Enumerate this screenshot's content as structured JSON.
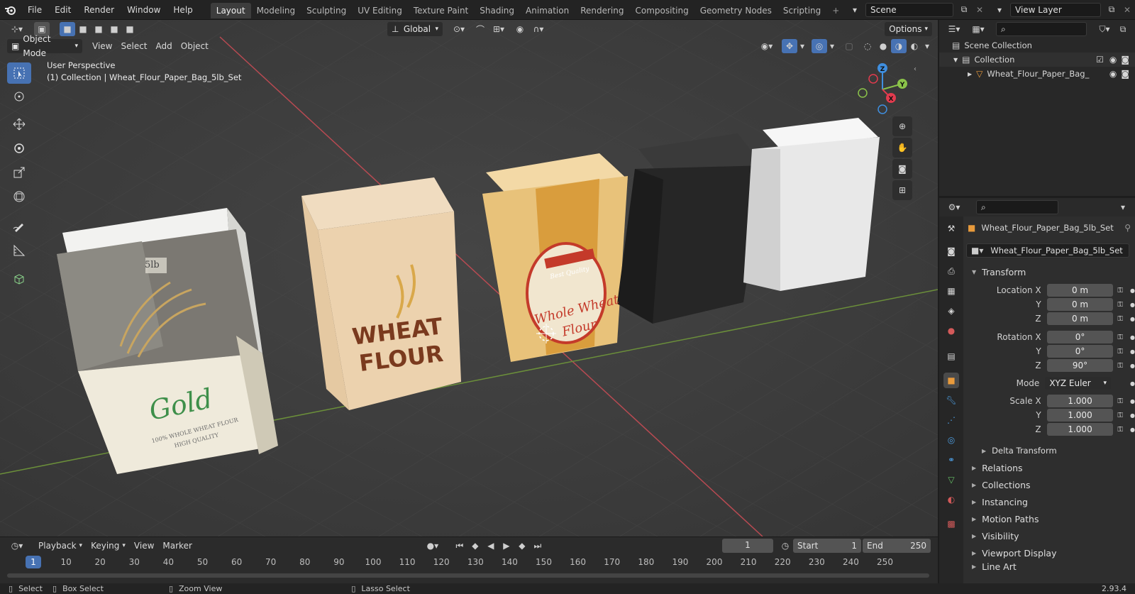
{
  "topbar": {
    "menus": [
      "File",
      "Edit",
      "Render",
      "Window",
      "Help"
    ],
    "workspaces": [
      "Layout",
      "Modeling",
      "Sculpting",
      "UV Editing",
      "Texture Paint",
      "Shading",
      "Animation",
      "Rendering",
      "Compositing",
      "Geometry Nodes",
      "Scripting"
    ],
    "active_workspace": "Layout",
    "add_tab_symbol": "+",
    "scene": "Scene",
    "view_layer": "View Layer"
  },
  "toolheader": {
    "orientation": "Global",
    "options": "Options"
  },
  "viewport_header": {
    "mode": "Object Mode",
    "menus": [
      "View",
      "Select",
      "Add",
      "Object"
    ]
  },
  "viewport": {
    "perspective_label": "User Perspective",
    "collection_label": "(1) Collection | Wheat_Flour_Paper_Bag_5lb_Set",
    "gizmo": {
      "x": "X",
      "y": "Y",
      "z": "Z"
    },
    "bags": {
      "gold": {
        "weight": "5lb",
        "brand": "Gold",
        "line1": "100% WHOLE WHEAT FLOUR",
        "line2": "HIGH QUALITY"
      },
      "wheat": {
        "line1": "WHEAT",
        "line2": "FLOUR"
      },
      "whole": {
        "ribbon": "Best Quality",
        "line1": "Whole Wheat",
        "line2": "Flour"
      }
    }
  },
  "outliner": {
    "scene_collection": "Scene Collection",
    "collection": "Collection",
    "object": "Wheat_Flour_Paper_Bag_"
  },
  "properties": {
    "object_name": "Wheat_Flour_Paper_Bag_5lb_Set",
    "data_name": "Wheat_Flour_Paper_Bag_5lb_Set",
    "transform_title": "Transform",
    "location": {
      "label_x": "Location X",
      "label_y": "Y",
      "label_z": "Z",
      "x": "0 m",
      "y": "0 m",
      "z": "0 m"
    },
    "rotation": {
      "label_x": "Rotation X",
      "label_y": "Y",
      "label_z": "Z",
      "x": "0°",
      "y": "0°",
      "z": "90°"
    },
    "mode": {
      "label": "Mode",
      "value": "XYZ Euler"
    },
    "scale": {
      "label_x": "Scale X",
      "label_y": "Y",
      "label_z": "Z",
      "x": "1.000",
      "y": "1.000",
      "z": "1.000"
    },
    "delta": "Delta Transform",
    "panels": [
      "Relations",
      "Collections",
      "Instancing",
      "Motion Paths",
      "Visibility",
      "Viewport Display",
      "Line Art"
    ]
  },
  "timeline": {
    "menus": [
      "Playback",
      "Keying",
      "View",
      "Marker"
    ],
    "current_frame": "1",
    "start_label": "Start",
    "start": "1",
    "end_label": "End",
    "end": "250",
    "ruler": [
      "1",
      "10",
      "20",
      "30",
      "40",
      "50",
      "60",
      "70",
      "80",
      "90",
      "100",
      "110",
      "120",
      "130",
      "140",
      "150",
      "160",
      "170",
      "180",
      "190",
      "200",
      "210",
      "220",
      "230",
      "240",
      "250"
    ]
  },
  "statusbar": {
    "select": "Select",
    "box_select": "Box Select",
    "zoom_view": "Zoom View",
    "lasso_select": "Lasso Select",
    "version": "2.93.4"
  },
  "colors": {
    "accent": "#4772b3",
    "active_tab": "#3d3d3d",
    "x_axis": "#e23b4e",
    "y_axis": "#8bc34a",
    "z_axis": "#3f8fe0"
  }
}
